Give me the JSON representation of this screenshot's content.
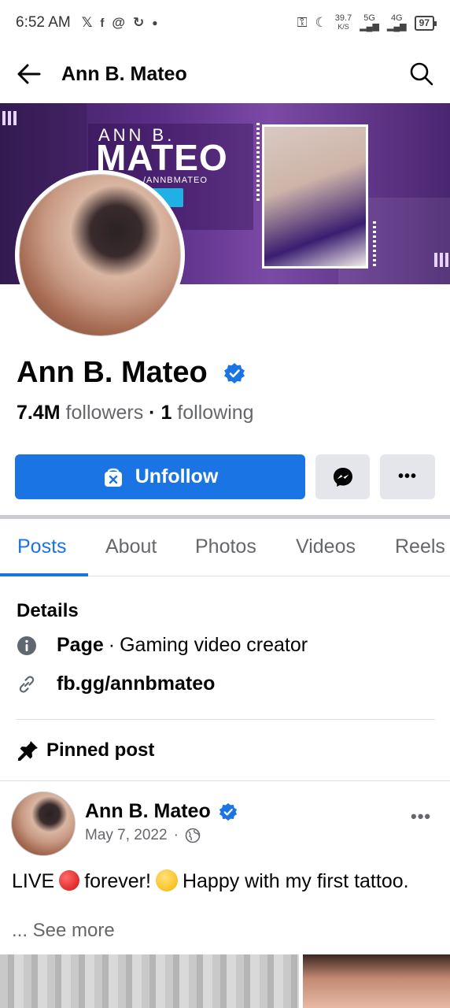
{
  "status_bar": {
    "time": "6:52 AM",
    "net_speed_value": "39.7",
    "net_speed_unit": "K/S",
    "sig1": "5G",
    "sig2": "4G",
    "battery": "97"
  },
  "header": {
    "title": "Ann B. Mateo"
  },
  "cover": {
    "name_small": "ANN B.",
    "name_big": "MATEO",
    "handle": "/ANNBMATEO"
  },
  "profile": {
    "name": "Ann B. Mateo",
    "followers_count": "7.4M",
    "followers_label": "followers",
    "dot": "·",
    "following_count": "1",
    "following_label": "following",
    "verified_color": "#1b74e4"
  },
  "actions": {
    "unfollow_label": "Unfollow",
    "more_label": "•••"
  },
  "tabs": [
    {
      "label": "Posts",
      "active": true
    },
    {
      "label": "About",
      "active": false
    },
    {
      "label": "Photos",
      "active": false
    },
    {
      "label": "Videos",
      "active": false
    },
    {
      "label": "Reels",
      "active": false
    }
  ],
  "details": {
    "title": "Details",
    "page_label": "Page",
    "sep": "·",
    "category": "Gaming video creator",
    "link": "fb.gg/annbmateo"
  },
  "pinned": {
    "label": "Pinned post"
  },
  "post": {
    "author": "Ann B. Mateo",
    "date": "May 7, 2022",
    "date_sep": "·",
    "more": "•••",
    "text_a": "LIVE",
    "text_b": "forever!",
    "text_c": "Happy with my first tattoo.",
    "see_more": "... See more"
  },
  "colors": {
    "accent": "#1b74e4",
    "secondary_button": "#e4e6eb",
    "muted_text": "#65676b"
  }
}
